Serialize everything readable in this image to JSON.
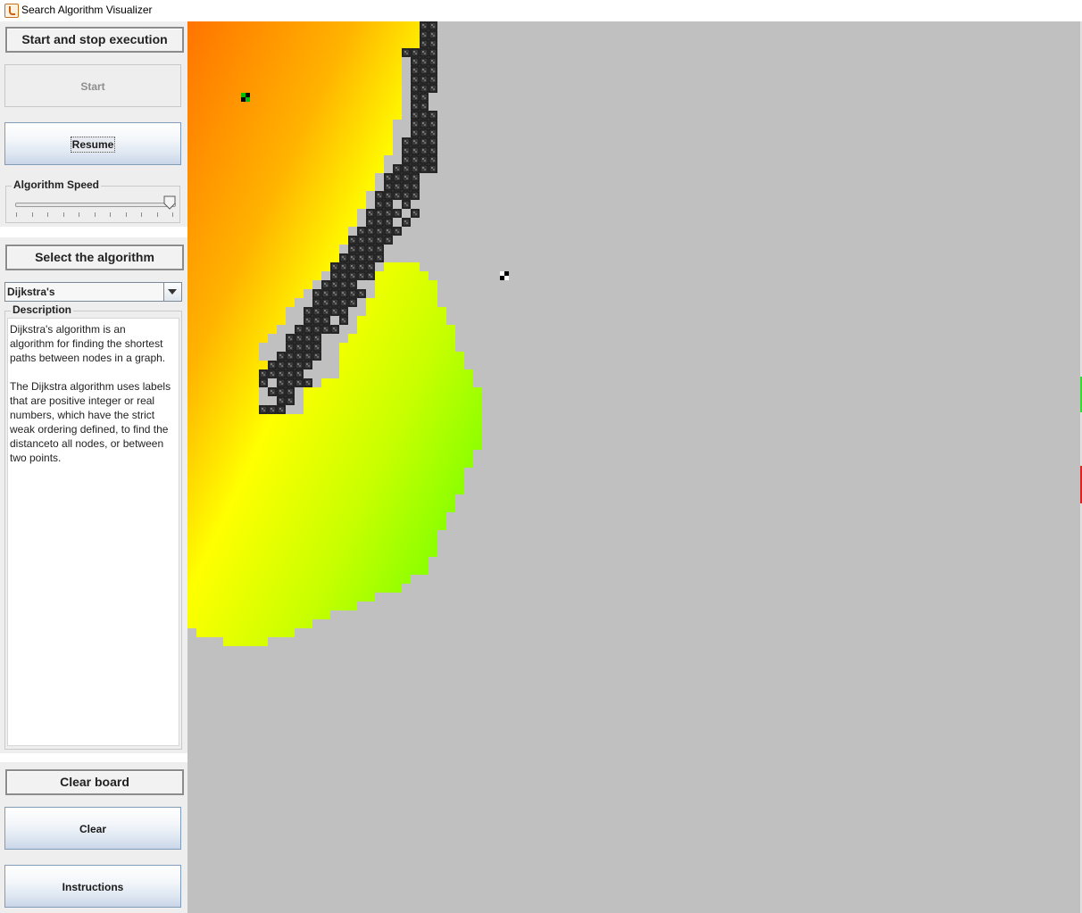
{
  "window": {
    "title": "Search Algorithm Visualizer"
  },
  "execution": {
    "header": "Start and stop execution",
    "start_label": "Start",
    "resume_label": "Resume",
    "speed_label": "Algorithm Speed",
    "speed_value": 0.97
  },
  "algorithm": {
    "header": "Select the algorithm",
    "selected": "Dijkstra's",
    "description_label": "Description",
    "description": "Dijkstra's algorithm is an\nalgorithm for finding the shortest\npaths between nodes in a graph.\n\nThe Dijkstra algorithm uses labels\nthat are positive integer or real\nnumbers, which have the strict\nweak ordering defined, to find the\ndistanceto all nodes, or between\ntwo points."
  },
  "board_controls": {
    "header": "Clear board",
    "clear_label": "Clear",
    "instructions_label": "Instructions"
  },
  "colors": {
    "grid_background": "#c0c0c0",
    "wall": "#3a3a3a",
    "start_node": "#00c000",
    "goal_node": "#000000",
    "gradient_far": "#ff7a00",
    "gradient_mid": "#ffff00",
    "gradient_near": "#55ff00"
  }
}
